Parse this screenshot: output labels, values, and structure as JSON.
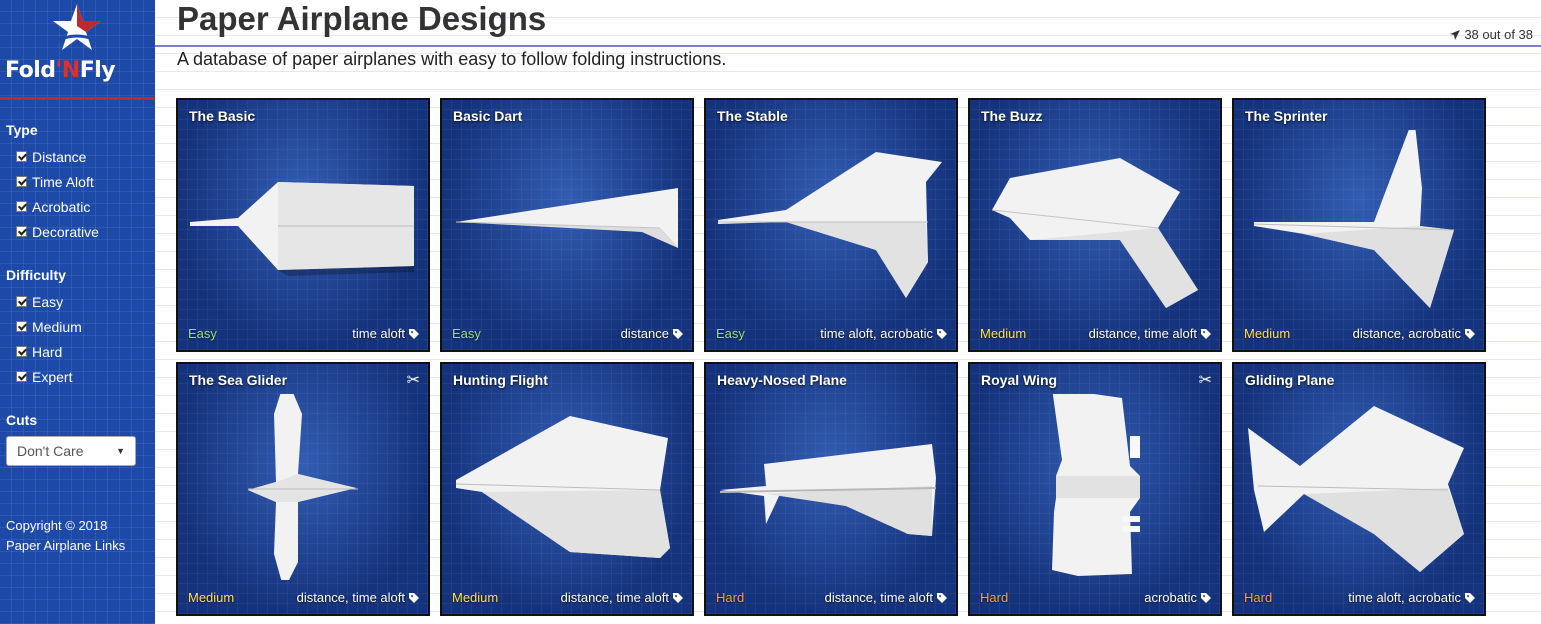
{
  "brand": {
    "name_part1": "Fold",
    "name_apostrophe": "'N",
    "name_part2": "Fly",
    "accent_color": "#c0282a"
  },
  "sidebar": {
    "type_title": "Type",
    "type_filters": [
      "Distance",
      "Time Aloft",
      "Acrobatic",
      "Decorative"
    ],
    "difficulty_title": "Difficulty",
    "difficulty_filters": [
      "Easy",
      "Medium",
      "Hard",
      "Expert"
    ],
    "cuts_title": "Cuts",
    "cuts_value": "Don't Care",
    "copyright_line1": "Copyright © 2018",
    "copyright_line2": "Paper Airplane Links"
  },
  "header": {
    "title": "Paper Airplane Designs",
    "subtitle": "A database of paper airplanes with easy to follow folding instructions.",
    "count": "38 out of 38"
  },
  "difficulty_colors": {
    "Easy": "#9be07a",
    "Medium": "#ffe14a",
    "Hard": "#ff9f2e"
  },
  "cards": [
    {
      "title": "The Basic",
      "difficulty": "Easy",
      "tags": "time aloft",
      "cuts": false
    },
    {
      "title": "Basic Dart",
      "difficulty": "Easy",
      "tags": "distance",
      "cuts": false
    },
    {
      "title": "The Stable",
      "difficulty": "Easy",
      "tags": "time aloft, acrobatic",
      "cuts": false
    },
    {
      "title": "The Buzz",
      "difficulty": "Medium",
      "tags": "distance, time aloft",
      "cuts": false
    },
    {
      "title": "The Sprinter",
      "difficulty": "Medium",
      "tags": "distance, acrobatic",
      "cuts": false
    },
    {
      "title": "The Sea Glider",
      "difficulty": "Medium",
      "tags": "distance, time aloft",
      "cuts": true
    },
    {
      "title": "Hunting Flight",
      "difficulty": "Medium",
      "tags": "distance, time aloft",
      "cuts": false
    },
    {
      "title": "Heavy-Nosed Plane",
      "difficulty": "Hard",
      "tags": "distance, time aloft",
      "cuts": false
    },
    {
      "title": "Royal Wing",
      "difficulty": "Hard",
      "tags": "acrobatic",
      "cuts": true
    },
    {
      "title": "Gliding Plane",
      "difficulty": "Hard",
      "tags": "time aloft, acrobatic",
      "cuts": false
    }
  ]
}
